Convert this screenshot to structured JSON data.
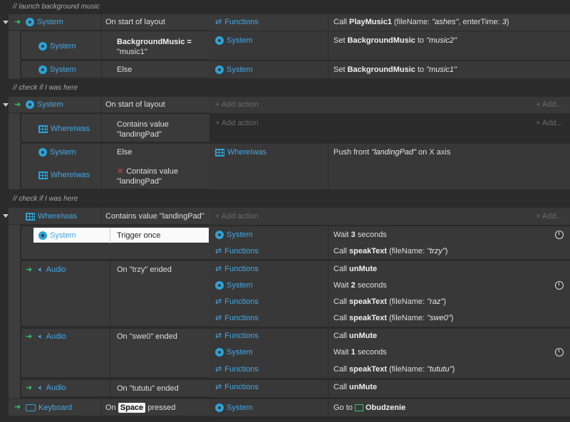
{
  "comments": [
    "launch background music",
    "check if I was here",
    "check if I was here"
  ],
  "labels": {
    "system": "System",
    "functions": "Functions",
    "whereiwas": "WhereIwas",
    "audio": "Audio",
    "keyboard": "Keyboard",
    "add_action": "+ Add action",
    "add_more": "+ Add...",
    "else": "Else",
    "trigger_once": "Trigger once"
  },
  "e1": {
    "cond1": "On start of layout",
    "act1": {
      "pre": "Call ",
      "fn": "PlayMusic1",
      "args_a": " (fileName: ",
      "v1": "\"ashes\"",
      "args_b": ", enterTime: ",
      "v2": "3",
      "args_c": ")"
    },
    "sub1_cond_a": "BackgroundMusic =",
    "sub1_cond_b": "\"music1\"",
    "sub1_act": {
      "pre": "Set ",
      "var": "BackgroundMusic",
      "mid": " to ",
      "val": "\"music2\""
    },
    "sub2_act": {
      "pre": "Set ",
      "var": "BackgroundMusic",
      "mid": " to ",
      "val": "\"music1\""
    }
  },
  "e2": {
    "cond1": "On start of layout",
    "sub1_cond_a": "Contains value",
    "sub1_cond_b": "\"landingPad\"",
    "sub2_cond_a": "Contains value",
    "sub2_cond_b": "\"landingPad\"",
    "sub2_act": {
      "pre": "Push front ",
      "val": "\"landingPad\"",
      "post": " on X axis"
    }
  },
  "e3": {
    "cond1": "Contains value \"landingPad\"",
    "s1_act1": {
      "pre": "Wait ",
      "num": "3",
      "post": " seconds"
    },
    "s1_act2": {
      "pre": "Call ",
      "fn": "speakText",
      "a": " (fileName: ",
      "v": "\"trzy\"",
      "c": ")"
    },
    "s2_cond": "On \"trzy\" ended",
    "s2_act1": {
      "pre": "Call ",
      "fn": "unMute"
    },
    "s2_act2": {
      "pre": "Wait ",
      "num": "2",
      "post": " seconds"
    },
    "s2_act3": {
      "pre": "Call ",
      "fn": "speakText",
      "a": " (fileName: ",
      "v": "\"raz\"",
      "c": ")"
    },
    "s2_act4": {
      "pre": "Call ",
      "fn": "speakText",
      "a": " (fileName: ",
      "v": "\"swe0\"",
      "c": ")"
    },
    "s3_cond": "On \"swe0\" ended",
    "s3_act1": {
      "pre": "Call ",
      "fn": "unMute"
    },
    "s3_act2": {
      "pre": "Wait ",
      "num": "1",
      "post": " seconds"
    },
    "s3_act3": {
      "pre": "Call ",
      "fn": "speakText",
      "a": " (fileName: ",
      "v": "\"tututu\"",
      "c": ")"
    },
    "s4_cond": "On \"tututu\" ended",
    "s4_act1": {
      "pre": "Call ",
      "fn": "unMute"
    }
  },
  "e4": {
    "cond_pre": "On ",
    "key": "Space",
    "cond_post": " pressed",
    "act_pre": "Go to ",
    "layout": "Obudzenie"
  },
  "colors": {
    "accent": "#45a7e3",
    "trigger": "#33c26b",
    "bg": "#2b2b2b",
    "block": "#3a3a3a"
  }
}
